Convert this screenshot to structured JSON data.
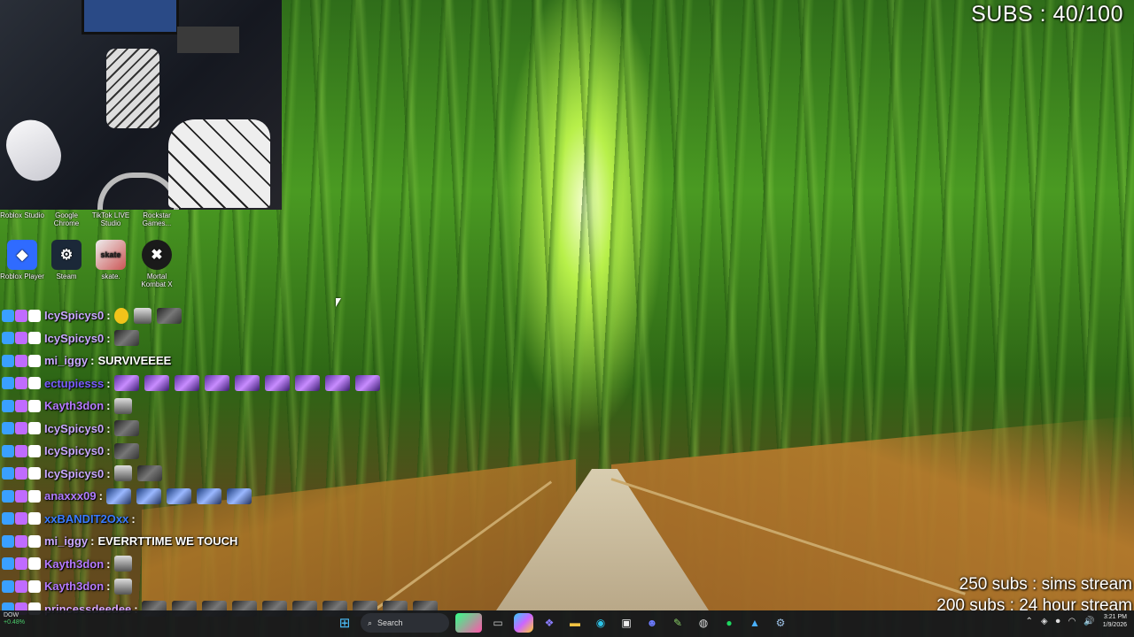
{
  "overlay": {
    "subs_counter": "SUBS : 40/100",
    "goals": [
      "250 subs : sims stream",
      "200 subs : 24 hour stream"
    ]
  },
  "desktop_icons": [
    {
      "label": "Roblox Studio",
      "icon": "roblox-studio-icon",
      "color": "#1a7ad9"
    },
    {
      "label": "Google Chrome",
      "icon": "chrome-icon",
      "color": "#e94235"
    },
    {
      "label": "TikTok LIVE Studio",
      "icon": "tiktok-icon",
      "color": "#111111"
    },
    {
      "label": "Rockstar Games...",
      "icon": "rockstar-icon",
      "color": "#f5a623"
    },
    {
      "label": "Roblox Player",
      "icon": "roblox-player-icon",
      "color": "#2f6bff"
    },
    {
      "label": "Steam",
      "icon": "steam-icon",
      "color": "#1b2838"
    },
    {
      "label": "skate.",
      "icon": "skate-icon",
      "color": "#ffffff"
    },
    {
      "label": "Mortal Kombat X",
      "icon": "mortal-kombat-icon",
      "color": "#1a1a1a"
    }
  ],
  "chat": [
    {
      "user": "IcySpicys0",
      "user_color": "#c9a8ff",
      "text": "",
      "emotes": [
        "yellow",
        "figure",
        "grey"
      ]
    },
    {
      "user": "IcySpicys0",
      "user_color": "#c9a8ff",
      "text": "",
      "emotes": [
        "grey"
      ]
    },
    {
      "user": "mi_iggy",
      "user_color": "#c9a8ff",
      "text": "SURVIVEEEE",
      "emotes": []
    },
    {
      "user": "ectupiesss",
      "user_color": "#7a5cff",
      "text": "",
      "emotes": [
        "purple",
        "purple",
        "purple",
        "purple",
        "purple",
        "purple",
        "purple",
        "purple",
        "purple"
      ]
    },
    {
      "user": "Kayth3don",
      "user_color": "#b57aff",
      "text": "",
      "emotes": [
        "figure"
      ]
    },
    {
      "user": "IcySpicys0",
      "user_color": "#c9a8ff",
      "text": "",
      "emotes": [
        "grey"
      ]
    },
    {
      "user": "IcySpicys0",
      "user_color": "#c9a8ff",
      "text": "",
      "emotes": [
        "grey"
      ]
    },
    {
      "user": "IcySpicys0",
      "user_color": "#c9a8ff",
      "text": "",
      "emotes": [
        "figure",
        "grey"
      ]
    },
    {
      "user": "anaxxx09",
      "user_color": "#b07bff",
      "text": "",
      "emotes": [
        "blue",
        "blue",
        "blue",
        "blue",
        "blue"
      ]
    },
    {
      "user": "xxBANDIT2Oxx",
      "user_color": "#3a7bff",
      "text": "",
      "emotes": []
    },
    {
      "user": "mi_iggy",
      "user_color": "#c9a8ff",
      "text": "EVERRTTIME WE TOUCH",
      "emotes": []
    },
    {
      "user": "Kayth3don",
      "user_color": "#b57aff",
      "text": "",
      "emotes": [
        "figure"
      ]
    },
    {
      "user": "Kayth3don",
      "user_color": "#b57aff",
      "text": "",
      "emotes": [
        "figure"
      ]
    },
    {
      "user": "princessdeedee",
      "user_color": "#d9a6ff",
      "text": "",
      "emotes": [
        "grey",
        "grey",
        "grey",
        "grey",
        "grey",
        "grey",
        "grey",
        "grey",
        "grey",
        "grey"
      ]
    }
  ],
  "taskbar": {
    "stock_name": "DOW",
    "stock_change": "+0.48%",
    "search_placeholder": "Search",
    "apps": [
      "widgets-icon",
      "file-icon",
      "copilot-icon",
      "teams-icon",
      "file-explorer-icon",
      "edge-icon",
      "store-icon",
      "discord-icon",
      "app-icon",
      "obs-icon",
      "spotify-icon",
      "photos-icon",
      "steam-icon"
    ],
    "time": "3:21 PM",
    "date": "1/9/2026"
  }
}
